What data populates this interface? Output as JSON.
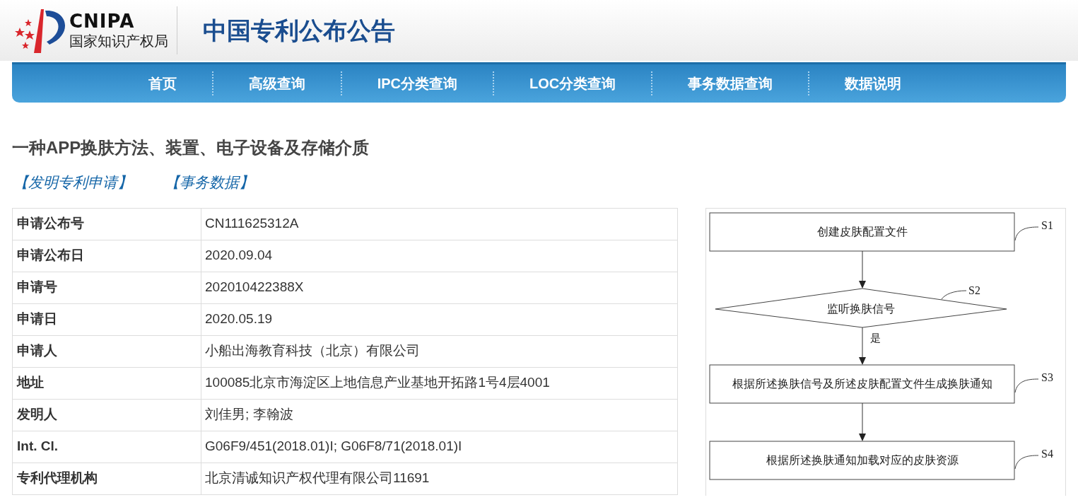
{
  "header": {
    "logo_abbr": "CNIPA",
    "logo_name": "国家知识产权局",
    "site_title": "中国专利公布公告"
  },
  "nav": {
    "items": [
      {
        "label": "首页"
      },
      {
        "label": "高级查询"
      },
      {
        "label": "IPC分类查询"
      },
      {
        "label": "LOC分类查询"
      },
      {
        "label": "事务数据查询"
      },
      {
        "label": "数据说明"
      }
    ]
  },
  "patent": {
    "title": "一种APP换肤方法、装置、电子设备及存储介质",
    "links": [
      "【发明专利申请】",
      "【事务数据】"
    ],
    "fields": [
      {
        "label": "申请公布号",
        "value": "CN111625312A"
      },
      {
        "label": "申请公布日",
        "value": "2020.09.04"
      },
      {
        "label": "申请号",
        "value": "202010422388X"
      },
      {
        "label": "申请日",
        "value": "2020.05.19"
      },
      {
        "label": "申请人",
        "value": "小船出海教育科技（北京）有限公司"
      },
      {
        "label": "地址",
        "value": "100085北京市海淀区上地信息产业基地开拓路1号4层4001"
      },
      {
        "label": "发明人",
        "value": "刘佳男;  李翰波"
      },
      {
        "label": "Int. Cl.",
        "value": "G06F9/451(2018.01)I;  G06F8/71(2018.01)I"
      },
      {
        "label": "专利代理机构",
        "value": "北京清诚知识产权代理有限公司11691"
      }
    ]
  },
  "drawing": {
    "steps": [
      {
        "kind": "process",
        "text": "创建皮肤配置文件",
        "step": "S1"
      },
      {
        "kind": "decision",
        "text": "监听换肤信号",
        "step": "S2",
        "branch": "是"
      },
      {
        "kind": "process",
        "text": "根据所述换肤信号及所述皮肤配置文件生成换肤通知",
        "step": "S3"
      },
      {
        "kind": "process",
        "text": "根据所述换肤通知加载对应的皮肤资源",
        "step": "S4"
      }
    ]
  }
}
